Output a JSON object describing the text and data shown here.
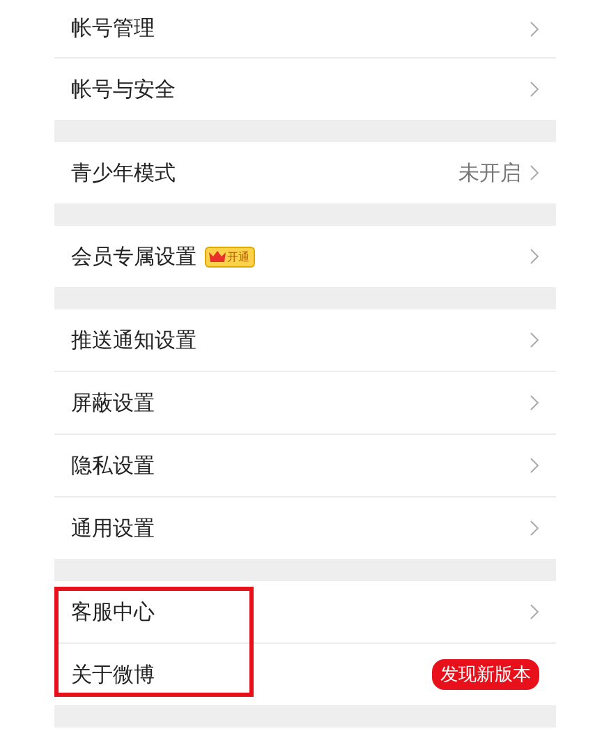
{
  "sections": [
    {
      "highlighted": false,
      "items": [
        {
          "label": "帐号管理"
        },
        {
          "label": "帐号与安全"
        }
      ]
    },
    {
      "highlighted": false,
      "items": [
        {
          "label": "青少年模式",
          "value": "未开启"
        }
      ]
    },
    {
      "highlighted": false,
      "items": [
        {
          "label": "会员专属设置",
          "badge": {
            "kind": "vip",
            "text": "开通"
          }
        }
      ]
    },
    {
      "highlighted": false,
      "items": [
        {
          "label": "推送通知设置"
        },
        {
          "label": "屏蔽设置"
        },
        {
          "label": "隐私设置"
        },
        {
          "label": "通用设置"
        }
      ]
    },
    {
      "highlighted": true,
      "items": [
        {
          "label": "客服中心"
        },
        {
          "label": "关于微博",
          "tag": "发现新版本"
        }
      ]
    }
  ]
}
